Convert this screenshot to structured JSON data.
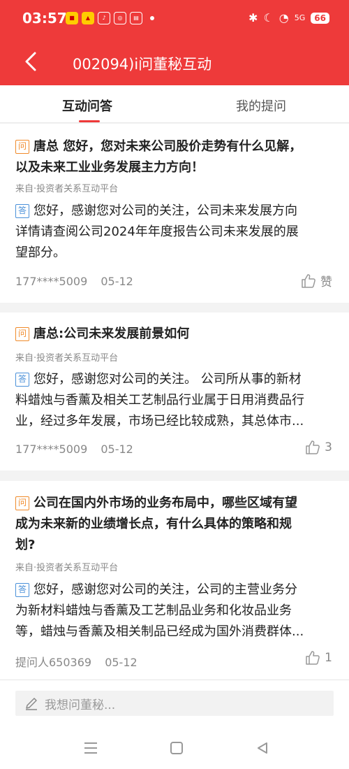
{
  "status_bar": {
    "time": "03:57",
    "apps": [
      "app-icon-1",
      "app-icon-2",
      "app-icon-3",
      "app-icon-4",
      "app-icon-5"
    ],
    "battery": "66",
    "network": "5G"
  },
  "navbar": {
    "title": "002094)i问董秘互动"
  },
  "tabs": [
    {
      "label": "互动问答",
      "active": true
    },
    {
      "label": "我的提问",
      "active": false
    }
  ],
  "qa_items": [
    {
      "question_lines": [
        "唐总 您好，您对未来公司股价走势有什么见解，",
        "以及未来工业业务发展主力方向！"
      ],
      "source": "来自·投资者关系互动平台",
      "answer_lines": [
        "您好，感谢您对公司的关注，公司未来发展方向",
        "详情请查阅公司2024年年度报告公司未来发展的展",
        "望部分。"
      ],
      "asker": "177****5009",
      "date": "05-12",
      "like": "赞"
    },
    {
      "question_lines": [
        "唐总:公司未来发展前景如何"
      ],
      "source": "来自·投资者关系互动平台",
      "answer_lines": [
        "您好，感谢您对公司的关注。 公司所从事的新材",
        "料蜡烛与香薰及相关工艺制品行业属于日用消费品行",
        "业，经过多年发展，市场已经比较成熟，其总体市..."
      ],
      "asker": "177****5009",
      "date": "05-12",
      "like": "3"
    },
    {
      "question_lines": [
        "公司在国内外市场的业务布局中，哪些区域有望",
        "成为未来新的业绩增长点，有什么具体的策略和规",
        "划?"
      ],
      "source": "来自·投资者关系互动平台",
      "answer_lines": [
        "您好，感谢您对公司的关注，公司的主营业务分",
        "为新材料蜡烛与香薰及工艺制品业务和化妆品业务",
        "等，蜡烛与香薰及相关制品已经成为国外消费群体..."
      ],
      "asker": "提问人650369",
      "date": "05-12",
      "like": "1"
    }
  ],
  "badges": {
    "question": "问",
    "answer": "答"
  },
  "input": {
    "placeholder": "我想问董秘..."
  },
  "colors": {
    "brand": "#ee3a3a",
    "question_badge": "#f08a2a",
    "answer_badge": "#4a90d9"
  }
}
